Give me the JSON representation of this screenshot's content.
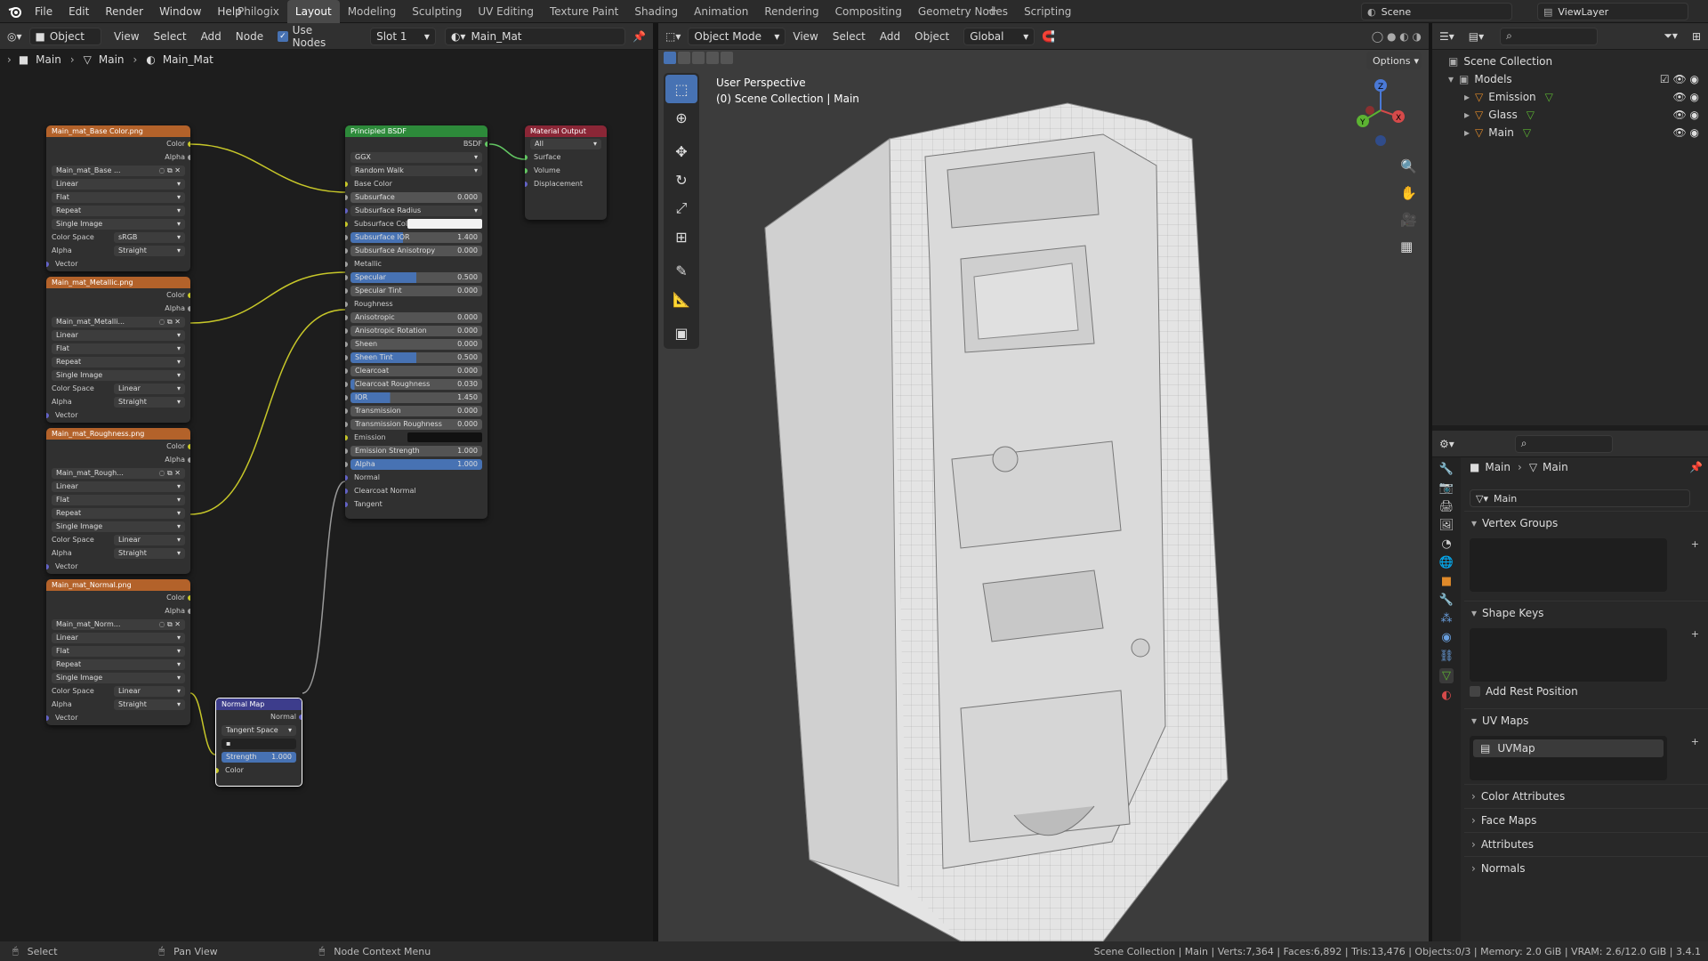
{
  "menu": [
    "File",
    "Edit",
    "Render",
    "Window",
    "Help"
  ],
  "workspaces": [
    "Philogix",
    "Layout",
    "Modeling",
    "Sculpting",
    "UV Editing",
    "Texture Paint",
    "Shading",
    "Animation",
    "Rendering",
    "Compositing",
    "Geometry Nodes",
    "Scripting"
  ],
  "active_workspace": "Layout",
  "scene": "Scene",
  "view_layer": "ViewLayer",
  "node_editor": {
    "object_label": "Object",
    "menu": [
      "View",
      "Select",
      "Add",
      "Node"
    ],
    "use_nodes": "Use Nodes",
    "slot": "Slot 1",
    "material": "Main_Mat",
    "breadcrumb": [
      "Main",
      "Main",
      "Main_Mat"
    ]
  },
  "texture_nodes": [
    {
      "title": "Main_mat_Base Color.png",
      "image": "Main_mat_Base ...",
      "colorspace": "sRGB"
    },
    {
      "title": "Main_mat_Metallic.png",
      "image": "Main_mat_Metalli...",
      "colorspace": "Linear"
    },
    {
      "title": "Main_mat_Roughness.png",
      "image": "Main_mat_Rough...",
      "colorspace": "Linear"
    },
    {
      "title": "Main_mat_Normal.png",
      "image": "Main_mat_Norm...",
      "colorspace": "Linear"
    }
  ],
  "tex_labels": {
    "color": "Color",
    "alpha": "Alpha",
    "interp": "Linear",
    "proj": "Flat",
    "ext": "Repeat",
    "src": "Single Image",
    "cs": "Color Space",
    "alpha_lbl": "Alpha",
    "alpha_mode": "Straight",
    "vector": "Vector"
  },
  "bsdf": {
    "title": "Principled BSDF",
    "out": "BSDF",
    "dist": "GGX",
    "sss": "Random Walk",
    "rows": [
      {
        "l": "Base Color",
        "t": "sock"
      },
      {
        "l": "Subsurface",
        "v": "0.000"
      },
      {
        "l": "Subsurface Radius",
        "t": "drop"
      },
      {
        "l": "Subsurface Color",
        "t": "color"
      },
      {
        "l": "Subsurface IOR",
        "v": "1.400",
        "f": 0.4
      },
      {
        "l": "Subsurface Anisotropy",
        "v": "0.000"
      },
      {
        "l": "Metallic",
        "t": "sock"
      },
      {
        "l": "Specular",
        "v": "0.500",
        "f": 0.5
      },
      {
        "l": "Specular Tint",
        "v": "0.000"
      },
      {
        "l": "Roughness",
        "t": "sock"
      },
      {
        "l": "Anisotropic",
        "v": "0.000"
      },
      {
        "l": "Anisotropic Rotation",
        "v": "0.000"
      },
      {
        "l": "Sheen",
        "v": "0.000"
      },
      {
        "l": "Sheen Tint",
        "v": "0.500",
        "f": 0.5
      },
      {
        "l": "Clearcoat",
        "v": "0.000"
      },
      {
        "l": "Clearcoat Roughness",
        "v": "0.030",
        "f": 0.03
      },
      {
        "l": "IOR",
        "v": "1.450",
        "f": 0.3
      },
      {
        "l": "Transmission",
        "v": "0.000"
      },
      {
        "l": "Transmission Roughness",
        "v": "0.000"
      },
      {
        "l": "Emission",
        "t": "black"
      },
      {
        "l": "Emission Strength",
        "v": "1.000"
      },
      {
        "l": "Alpha",
        "v": "1.000",
        "f": 1
      },
      {
        "l": "Normal",
        "t": "sock"
      },
      {
        "l": "Clearcoat Normal",
        "t": "sock"
      },
      {
        "l": "Tangent",
        "t": "sock"
      }
    ]
  },
  "mat_output": {
    "title": "Material Output",
    "target": "All",
    "inputs": [
      "Surface",
      "Volume",
      "Displacement"
    ]
  },
  "normal_map": {
    "title": "Normal Map",
    "out": "Normal",
    "space": "Tangent Space",
    "strength_lbl": "Strength",
    "strength": "1.000",
    "color": "Color"
  },
  "viewport": {
    "mode": "Object Mode",
    "menu": [
      "View",
      "Select",
      "Add",
      "Object"
    ],
    "orientation": "Global",
    "options": "Options",
    "overlay_title": "User Perspective",
    "overlay_sub": "(0) Scene Collection | Main"
  },
  "outliner": {
    "root": "Scene Collection",
    "collection": "Models",
    "items": [
      "Emission",
      "Glass",
      "Main"
    ]
  },
  "properties": {
    "breadcrumb": [
      "Main",
      "Main"
    ],
    "mesh_name": "Main",
    "sections": [
      "Vertex Groups",
      "Shape Keys",
      "UV Maps",
      "Color Attributes",
      "Face Maps",
      "Attributes",
      "Normals"
    ],
    "add_rest": "Add Rest Position",
    "uvmap": "UVMap"
  },
  "status": {
    "left": [
      {
        "icon": "mouse-left-icon",
        "t": "Select"
      },
      {
        "icon": "mouse-middle-icon",
        "t": "Pan View"
      },
      {
        "icon": "mouse-right-icon",
        "t": "Node Context Menu"
      }
    ],
    "right": "Scene Collection | Main | Verts:7,364 | Faces:6,892 | Tris:13,476 | Objects:0/3 | Memory: 2.0 GiB | VRAM: 2.6/12.0 GiB | 3.4.1"
  },
  "colors": {
    "tex_header": "#b3622a",
    "bsdf_header": "#2d8a3a",
    "output_header": "#8a2636",
    "normal_header": "#3d3d8c",
    "link_yellow": "#c7c729",
    "link_gray": "#9a9a9a",
    "accent": "#4772b3"
  }
}
